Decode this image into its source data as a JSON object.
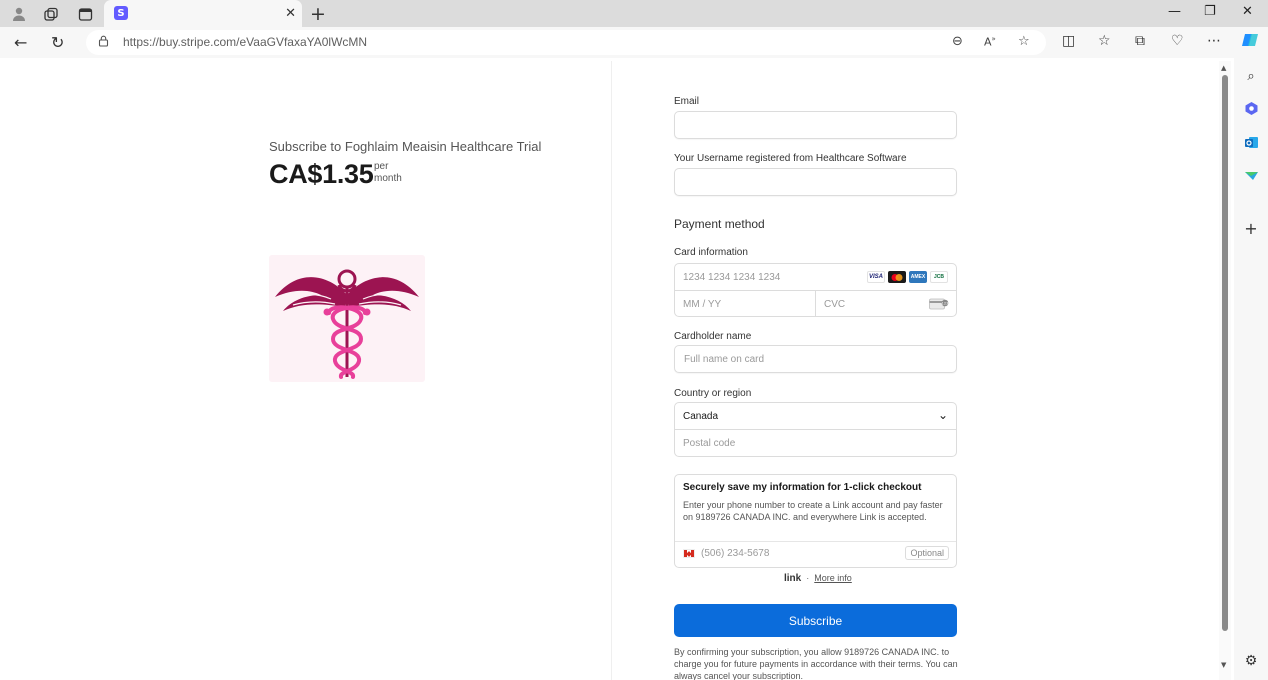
{
  "browser": {
    "tab_title": "",
    "tab_favicon": "S",
    "url_host": "https://buy.stripe.com",
    "url_path": "/eVaaGVfaxaYA0lWcMN",
    "icons": [
      "profile-icon",
      "workspaces-icon",
      "tab-actions-icon",
      "close-icon",
      "new-tab-icon",
      "minimize-icon",
      "maximize-icon",
      "window-close-icon",
      "back-icon",
      "refresh-icon",
      "lock-icon",
      "zoom-icon",
      "read-aloud-icon",
      "favorite-star-icon",
      "split-screen-icon",
      "favorites-icon",
      "collections-icon",
      "browser-essentials-icon",
      "more-icon",
      "copilot-icon"
    ]
  },
  "sidebar": {
    "icons": [
      "search-icon",
      "copilot-app-icon",
      "outlook-icon",
      "drop-icon",
      "add-icon",
      "settings-icon"
    ]
  },
  "product": {
    "name": "Subscribe to Foghlaim Meaisin Healthcare Trial",
    "price": "CA$1.35",
    "per_line1": "per",
    "per_line2": "month",
    "image_icon": "caduceus-icon"
  },
  "form": {
    "email_label": "Email",
    "email_value": "",
    "username_label": "Your Username registered from Healthcare Software",
    "username_value": "",
    "payment_title": "Payment method",
    "card_label": "Card information",
    "card_number_placeholder": "1234 1234 1234 1234",
    "expiry_placeholder": "MM / YY",
    "cvc_placeholder": "CVC",
    "card_brands": [
      "VISA",
      "mastercard",
      "AMEX",
      "JCB"
    ],
    "cardholder_label": "Cardholder name",
    "cardholder_placeholder": "Full name on card",
    "country_label": "Country or region",
    "country_value": "Canada",
    "postal_placeholder": "Postal code",
    "link_title": "Securely save my information for 1-click checkout",
    "link_desc": "Enter your phone number to create a Link account and pay faster on 9189726 CANADA INC. and everywhere Link is accepted.",
    "phone_placeholder": "(506) 234-5678",
    "optional_badge": "Optional",
    "link_logo": "link",
    "link_more": "More info",
    "subscribe_label": "Subscribe",
    "terms": "By confirming your subscription, you allow 9189726 CANADA INC. to charge you for future payments in accordance with their terms. You can always cancel your subscription."
  },
  "colors": {
    "primary_button": "#0b6cdb",
    "stripe_brand": "#635bff",
    "caduceus_dark": "#9c1451",
    "caduceus_pink": "#e8409a"
  }
}
